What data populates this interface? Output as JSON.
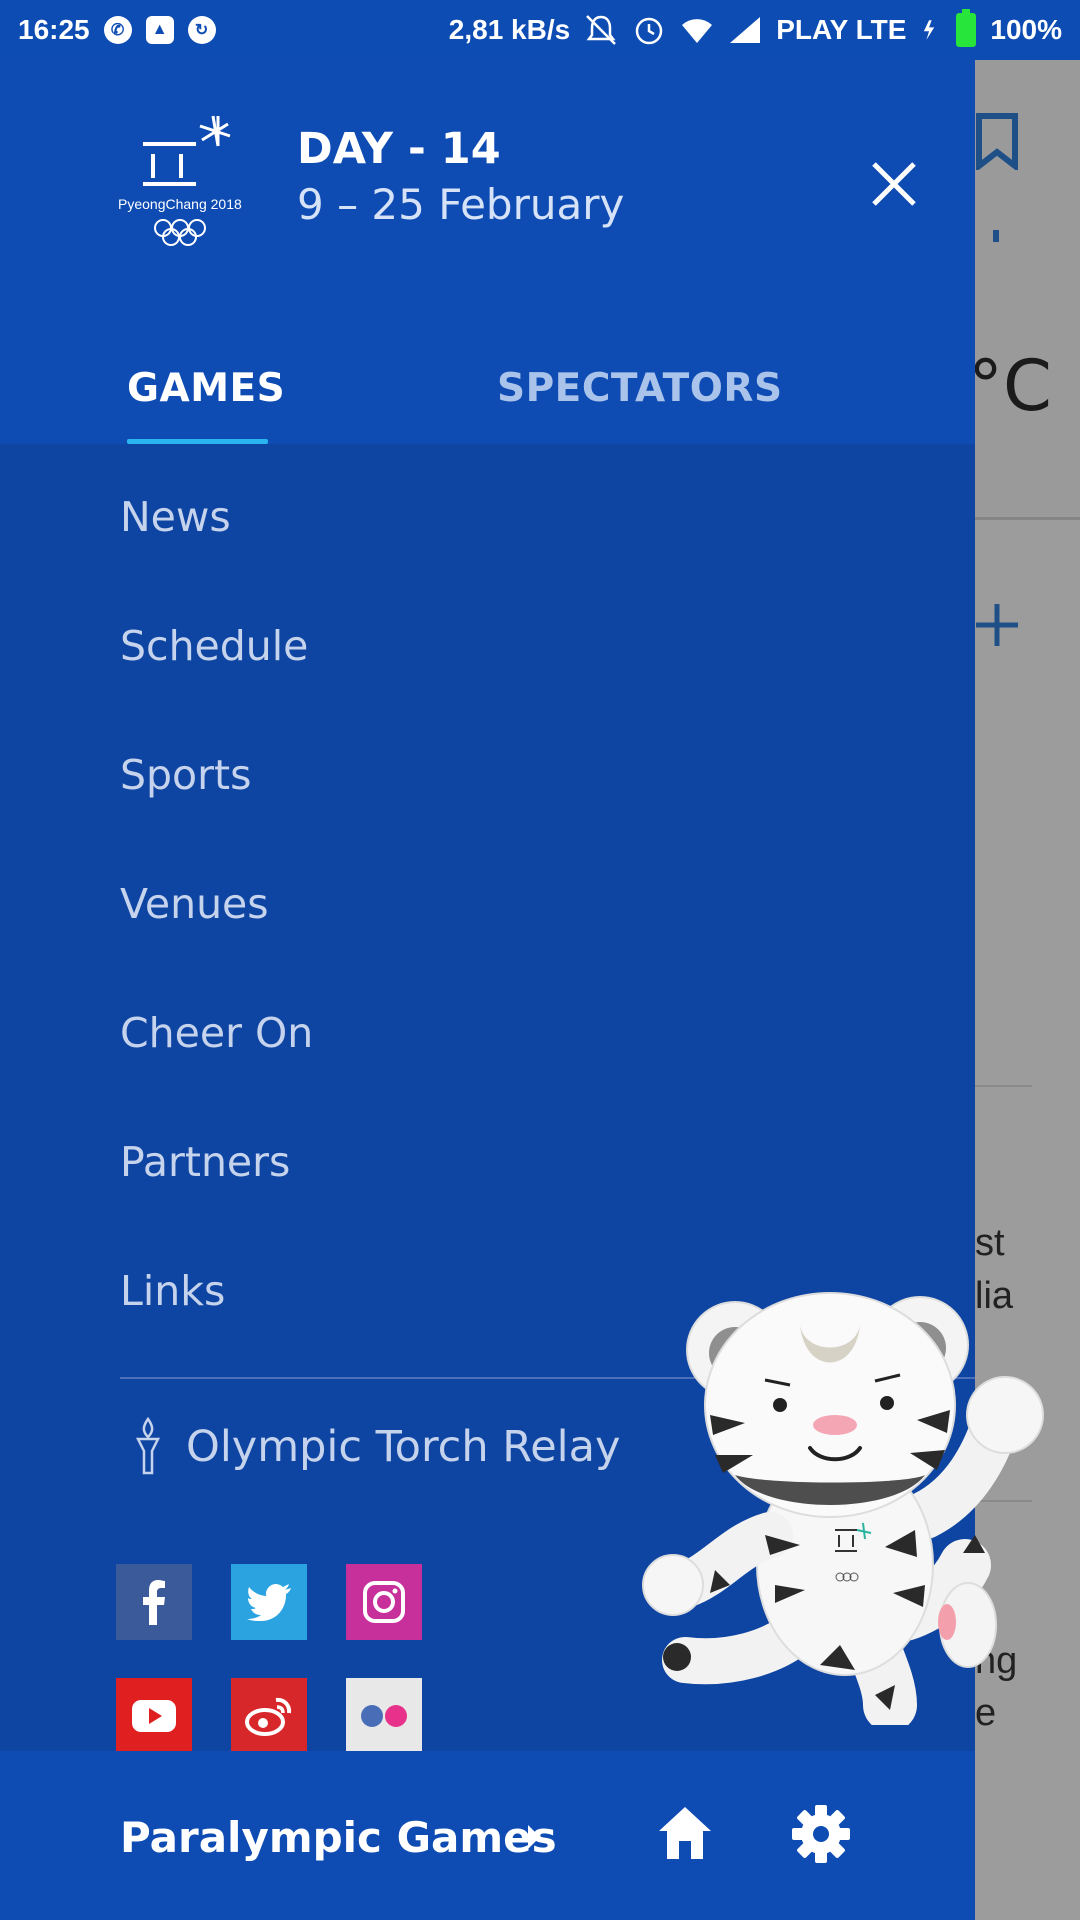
{
  "status_bar": {
    "time": "16:25",
    "speed": "2,81 kB/s",
    "carrier": "PLAY LTE",
    "battery": "100%",
    "icons": [
      "whatsapp-icon",
      "gallery-icon",
      "sync-icon",
      "mute-icon",
      "alarm-icon",
      "wifi-icon",
      "signal-icon",
      "charging-icon",
      "battery-icon"
    ]
  },
  "drawer": {
    "logo_text": "PyeongChang 2018",
    "day_title": "DAY - 14",
    "day_dates": "9 – 25 February",
    "tabs": [
      {
        "label": "GAMES",
        "active": true
      },
      {
        "label": "SPECTATORS",
        "active": false
      }
    ],
    "menu": [
      "News",
      "Schedule",
      "Sports",
      "Venues",
      "Cheer On",
      "Partners",
      "Links"
    ],
    "torch_label": "Olympic Torch Relay",
    "social": [
      "facebook-icon",
      "twitter-icon",
      "instagram-icon",
      "youtube-icon",
      "weibo-icon",
      "flickr-icon"
    ],
    "bottom": {
      "paralympic_label": "Paralympic Games"
    }
  },
  "background": {
    "temp_unit": "°C",
    "text1": "st",
    "text2": "lia",
    "text3": "ng",
    "text4": "e"
  },
  "colors": {
    "header_blue": "#0e4cb4",
    "drawer_blue": "#0f45a2",
    "tab_indicator": "#2ab4f0",
    "facebook": "#3b5a9a",
    "twitter": "#2aa3e0",
    "instagram": "#c7309b",
    "youtube": "#e02020",
    "weibo": "#d8272a",
    "flickr_bg": "#e8e8e8"
  }
}
